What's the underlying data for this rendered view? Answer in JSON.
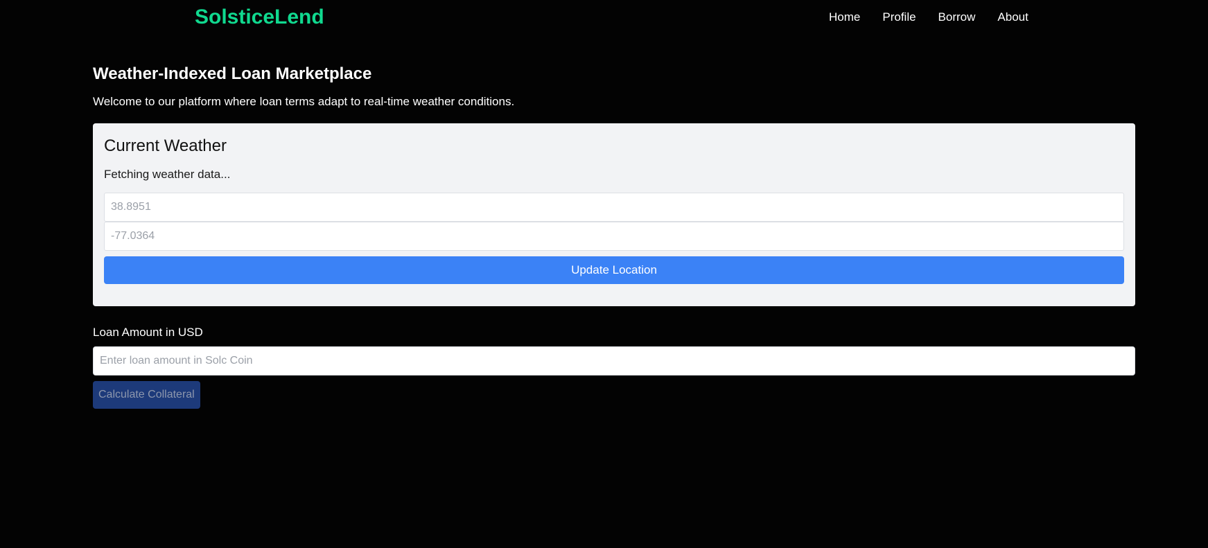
{
  "nav": {
    "brand": "SolsticeLend",
    "links": [
      "Home",
      "Profile",
      "Borrow",
      "About"
    ]
  },
  "page": {
    "title": "Weather-Indexed Loan Marketplace",
    "intro": "Welcome to our platform where loan terms adapt to real-time weather conditions."
  },
  "weather": {
    "title": "Current Weather",
    "status": "Fetching weather data...",
    "latitude_placeholder": "38.8951",
    "longitude_placeholder": "-77.0364",
    "update_button": "Update Location"
  },
  "loan": {
    "label": "Loan Amount in USD",
    "placeholder": "Enter loan amount in Solc Coin",
    "calculate_button": "Calculate Collateral"
  },
  "colors": {
    "brand": "#10d98f",
    "background": "#030303",
    "card": "#f2f3f5",
    "primary_button": "#3b82f6",
    "disabled_button": "#1d3a7a"
  }
}
